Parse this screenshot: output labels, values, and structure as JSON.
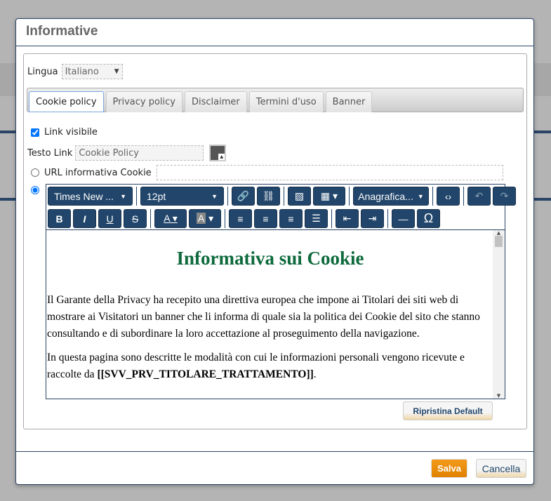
{
  "dialog": {
    "title": "Informative"
  },
  "lingua": {
    "label": "Lingua",
    "value": "Italiano"
  },
  "tabs": [
    {
      "label": "Cookie policy",
      "active": true
    },
    {
      "label": "Privacy policy"
    },
    {
      "label": "Disclaimer"
    },
    {
      "label": "Termini d'uso"
    },
    {
      "label": "Banner"
    }
  ],
  "link_visibile": {
    "label": "Link visibile",
    "checked": true
  },
  "testo_link": {
    "label": "Testo Link",
    "value": "Cookie Policy"
  },
  "url_option": {
    "label": "URL informativa Cookie",
    "value": ""
  },
  "toolbar": {
    "font": "Times New ...",
    "size": "12pt",
    "anagrafica": "Anagrafica...",
    "color_icon": "#22466b"
  },
  "content": {
    "heading": "Informativa sui Cookie",
    "p1": "Il Garante della Privacy ha recepito una direttiva europea che impone ai Titolari dei siti web di mostrare ai Visitatori un banner che li informa di quale sia la politica dei Cookie del sito che stanno consultando e di subordinare la loro accettazione al proseguimento della navigazione.",
    "p2_start": "In questa pagina sono descritte le modalità con cui le informazioni personali vengono ricevute e raccolte da ",
    "p2_bold": "[[SVV_PRV_TITOLARE_TRATTAMENTO]]",
    "p2_end": "."
  },
  "buttons": {
    "restore": "Ripristina Default",
    "save": "Salva",
    "cancel": "Cancella"
  }
}
